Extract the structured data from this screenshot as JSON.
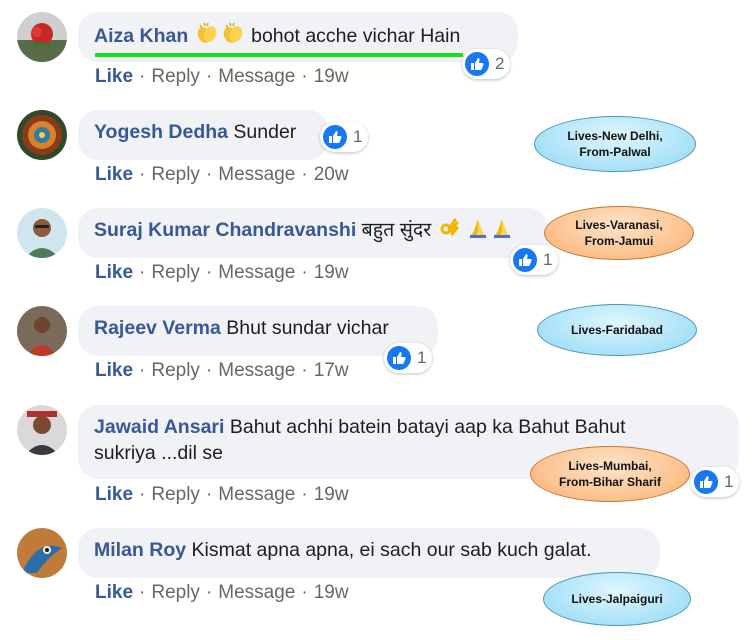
{
  "actions": {
    "like": "Like",
    "reply": "Reply",
    "message": "Message",
    "sep": "·"
  },
  "comments": [
    {
      "name": "Aiza Khan",
      "text": "bohot acche vichar Hain",
      "time": "19w",
      "reactions": "2",
      "emoji": "clapping-hands-icon"
    },
    {
      "name": "Yogesh Dedha",
      "text": "Sunder",
      "time": "20w",
      "reactions": "1"
    },
    {
      "name": "Suraj Kumar Chandravanshi",
      "text": "बहुत सुंदर",
      "time": "19w",
      "reactions": "1",
      "emoji": "ok-hand-and-folded-hands-icon"
    },
    {
      "name": "Rajeev Verma",
      "text": "Bhut sundar vichar",
      "time": "17w",
      "reactions": "1"
    },
    {
      "name": "Jawaid Ansari",
      "text_line1": "Bahut achhi batein batayi aap ka Bahut Bahut",
      "text_line2": "sukriya ...dil se",
      "time": "19w",
      "reactions": "1"
    },
    {
      "name": "Milan Roy",
      "text": "Kismat apna apna, ei sach our sab kuch galat.",
      "time": "19w"
    }
  ],
  "callouts": [
    {
      "line1": "Lives-New Delhi,",
      "line2": "From-Palwal",
      "color": "#a8e1f7"
    },
    {
      "line1": "Lives-Varanasi,",
      "line2": "From-Jamui",
      "color": "#fbbf8a"
    },
    {
      "line1": "Lives-Faridabad",
      "color": "#a8e1f7"
    },
    {
      "line1": "Lives-Mumbai,",
      "line2": "From-Bihar Sharif",
      "color": "#fbbf8a"
    },
    {
      "line1": "Lives-Jalpaiguri",
      "color": "#a8e1f7"
    }
  ],
  "colors": {
    "name": "#385898",
    "bubble": "#f0f2f5",
    "like_badge": "#1877f2",
    "highlight": "#14e414"
  }
}
